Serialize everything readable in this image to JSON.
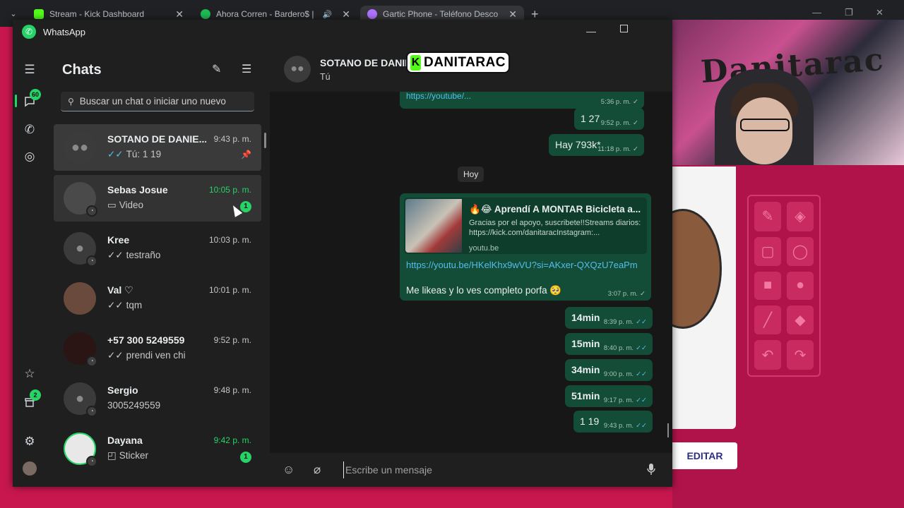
{
  "browser": {
    "tabs": [
      {
        "title": "Stream - Kick Dashboard",
        "icon": "kick-icon",
        "color": "#53fc18"
      },
      {
        "title": "Ahora Corren - Bardero$ | ",
        "icon": "spotify-icon",
        "color": "#1db954"
      },
      {
        "title": "Gartic Phone - Teléfono Descon",
        "icon": "gartic-icon",
        "color": "#b074ff"
      }
    ],
    "new_tab": "+"
  },
  "app": {
    "title": "WhatsApp",
    "accent": "#25d366"
  },
  "rail": {
    "chats_badge": "60",
    "archive_badge": "2"
  },
  "chatlist": {
    "title": "Chats",
    "search_placeholder": "Buscar un chat o iniciar uno nuevo",
    "chats": [
      {
        "name": "SOTANO DE DANIE...",
        "time": "9:43 p. m.",
        "preview": "Tú: 1 19",
        "tick": "✓✓",
        "tick_color": "blue",
        "pinned": true
      },
      {
        "name": "Sebas Josue",
        "time": "10:05 p. m.",
        "preview": "Video",
        "preview_icon": "video-icon",
        "unread": "1",
        "time_green": true
      },
      {
        "name": "Kree",
        "time": "10:03 p. m.",
        "preview": "testraño",
        "tick": "✓✓"
      },
      {
        "name": "Val ♡",
        "time": "10:01 p. m.",
        "preview": "tqm",
        "tick": "✓✓"
      },
      {
        "name": "+57 300 5249559",
        "time": "9:52 p. m.",
        "preview": "prendi ven chi",
        "tick": "✓✓"
      },
      {
        "name": "Sergio",
        "time": "9:48 p. m.",
        "preview": "3005249559"
      },
      {
        "name": "Dayana",
        "time": "9:42 p. m.",
        "preview": "Sticker",
        "preview_icon": "sticker-icon",
        "unread": "1",
        "time_green": true
      }
    ]
  },
  "conversation": {
    "name": "SOTANO DE DANIE",
    "subtitle": "Tú",
    "overlay_brand": "K",
    "overlay_name": "DANITARAC",
    "day_divider": "Hoy",
    "earlier": [
      {
        "text": "https://youtube/...",
        "time": "5:36 p. m."
      },
      {
        "text": "1 27",
        "time": "9:52 p. m."
      },
      {
        "text": "Hay 793k*",
        "time": "11:18 p. m."
      }
    ],
    "link_message": {
      "title": "🔥😂 Aprendí A MONTAR Bicicleta a...",
      "description": "Gracias por el apoyo, suscribete!!Streams diarios: https://kick.com/danitaracInstagram:...",
      "domain": "youtu.be",
      "url": "https://youtu.be/HKelKhx9wVU?si=AKxer-QXQzU7eaPm",
      "text": "Me likeas y lo ves completo porfa 🥺",
      "time": "3:07 p. m."
    },
    "short_messages": [
      {
        "text": "14min",
        "time": "8:39 p. m."
      },
      {
        "text": "15min",
        "time": "8:40 p. m."
      },
      {
        "text": "34min",
        "time": "9:00 p. m."
      },
      {
        "text": "51min",
        "time": "9:17 p. m."
      },
      {
        "text": "1 19",
        "time": "9:43 p. m."
      }
    ],
    "composer_placeholder": "Escribe un mensaje"
  },
  "game": {
    "edit_label": "EDITAR"
  },
  "webcam": {
    "graffiti": "Danitarac"
  }
}
